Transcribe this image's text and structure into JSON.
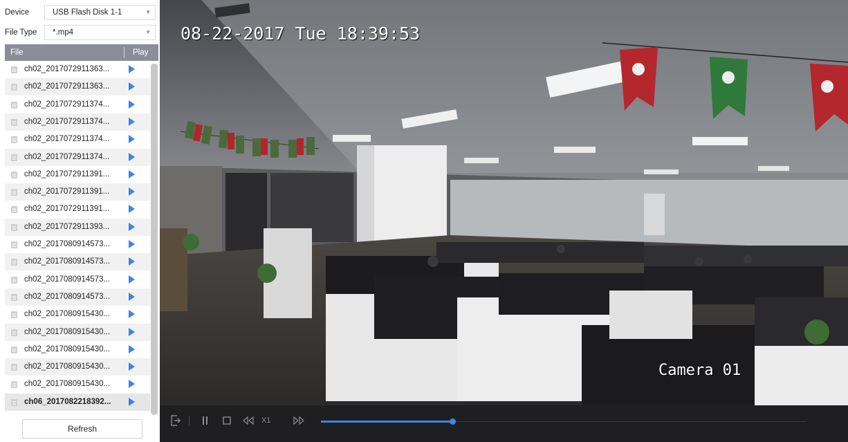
{
  "filters": {
    "device": {
      "label": "Device",
      "value": "USB Flash Disk 1-1"
    },
    "file_type": {
      "label": "File Type",
      "value": "*.mp4"
    }
  },
  "table": {
    "col_file": "File",
    "col_play": "Play",
    "files": [
      "ch02_2017072911363...",
      "ch02_2017072911363...",
      "ch02_2017072911374...",
      "ch02_2017072911374...",
      "ch02_2017072911374...",
      "ch02_2017072911374...",
      "ch02_2017072911391...",
      "ch02_2017072911391...",
      "ch02_2017072911391...",
      "ch02_2017072911393...",
      "ch02_2017080914573...",
      "ch02_2017080914573...",
      "ch02_2017080914573...",
      "ch02_2017080914573...",
      "ch02_2017080915430...",
      "ch02_2017080915430...",
      "ch02_2017080915430...",
      "ch02_2017080915430...",
      "ch02_2017080915430...",
      "ch06_2017082218392..."
    ],
    "selected_index": 19
  },
  "refresh_label": "Refresh",
  "player": {
    "osd_timestamp": "08-22-2017 Tue 18:39:53",
    "osd_camera": "Camera 01",
    "speed": "X1",
    "progress": 0.27
  },
  "icons": {
    "play": "play-icon",
    "exit": "exit-icon",
    "pause": "pause-icon",
    "stop": "stop-icon",
    "rewind": "rewind-icon",
    "forward": "fast-forward-icon"
  },
  "colors": {
    "accent": "#3d85e5",
    "header": "#8b8e96",
    "player_bg": "#1f1f22"
  }
}
